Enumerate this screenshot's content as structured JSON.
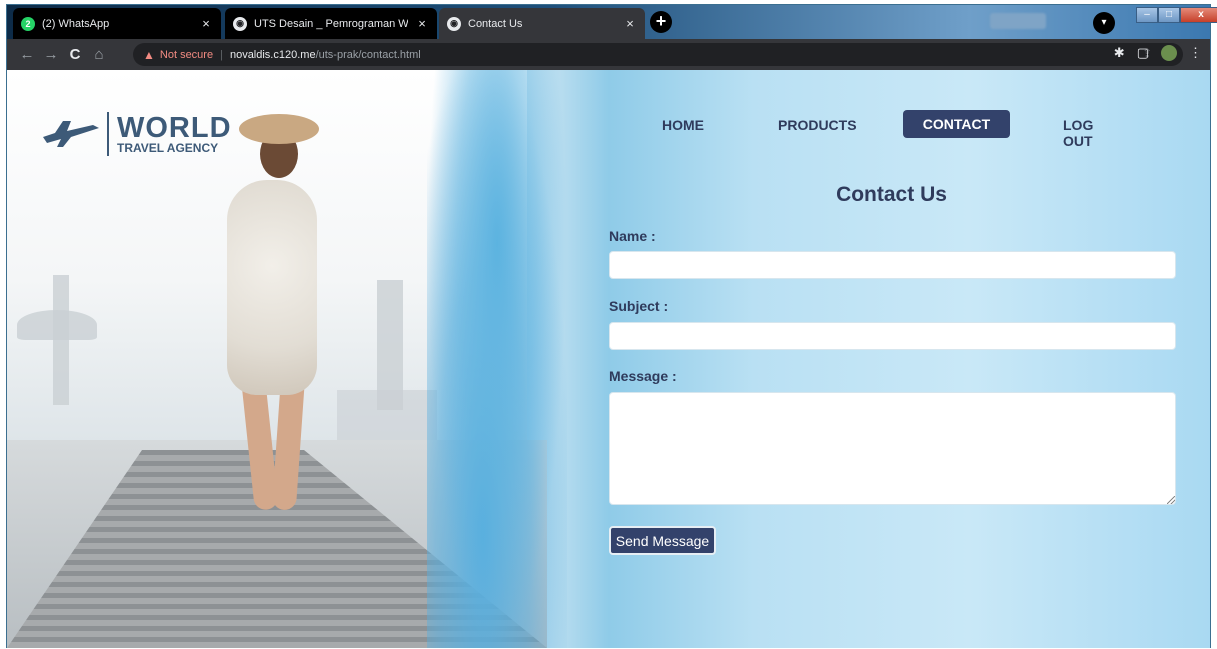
{
  "browser": {
    "tabs": [
      {
        "title": "(2) WhatsApp",
        "favicon": "whatsapp-icon",
        "badge": "2",
        "active": false
      },
      {
        "title": "UTS Desain _ Pemrograman Web",
        "favicon": "globe-icon",
        "active": false
      },
      {
        "title": "Contact Us",
        "favicon": "globe-icon",
        "active": true
      }
    ],
    "new_tab_label": "+",
    "address": {
      "security_label": "Not secure",
      "url_host": "novaldis.c120.me",
      "url_path": "/uts-prak/contact.html"
    },
    "icons": {
      "back": "←",
      "forward": "→",
      "reload": "C",
      "home": "⌂",
      "share": "⇪",
      "star": "☆",
      "extensions": "✱",
      "sidebar": "▢",
      "menu": "⋮",
      "close": "×",
      "minimize": "–",
      "maximize": "□",
      "window_close": "x"
    }
  },
  "site": {
    "logo": {
      "main": "WORLD",
      "sub": "TRAVEL AGENCY",
      "icon": "airplane-icon"
    },
    "nav": {
      "home": "HOME",
      "products": "PRODUCTS",
      "contact": "CONTACT",
      "logout": "LOG OUT",
      "active": "CONTACT"
    },
    "form": {
      "title": "Contact Us",
      "name_label": "Name :",
      "name_value": "",
      "subject_label": "Subject :",
      "subject_value": "",
      "message_label": "Message :",
      "message_value": "",
      "submit_label": "Send Message"
    },
    "colors": {
      "brand_dark": "#33426b",
      "text": "#2f3b5c",
      "logo": "#3d5a78",
      "accent_blue": "#8fcbe8"
    }
  }
}
